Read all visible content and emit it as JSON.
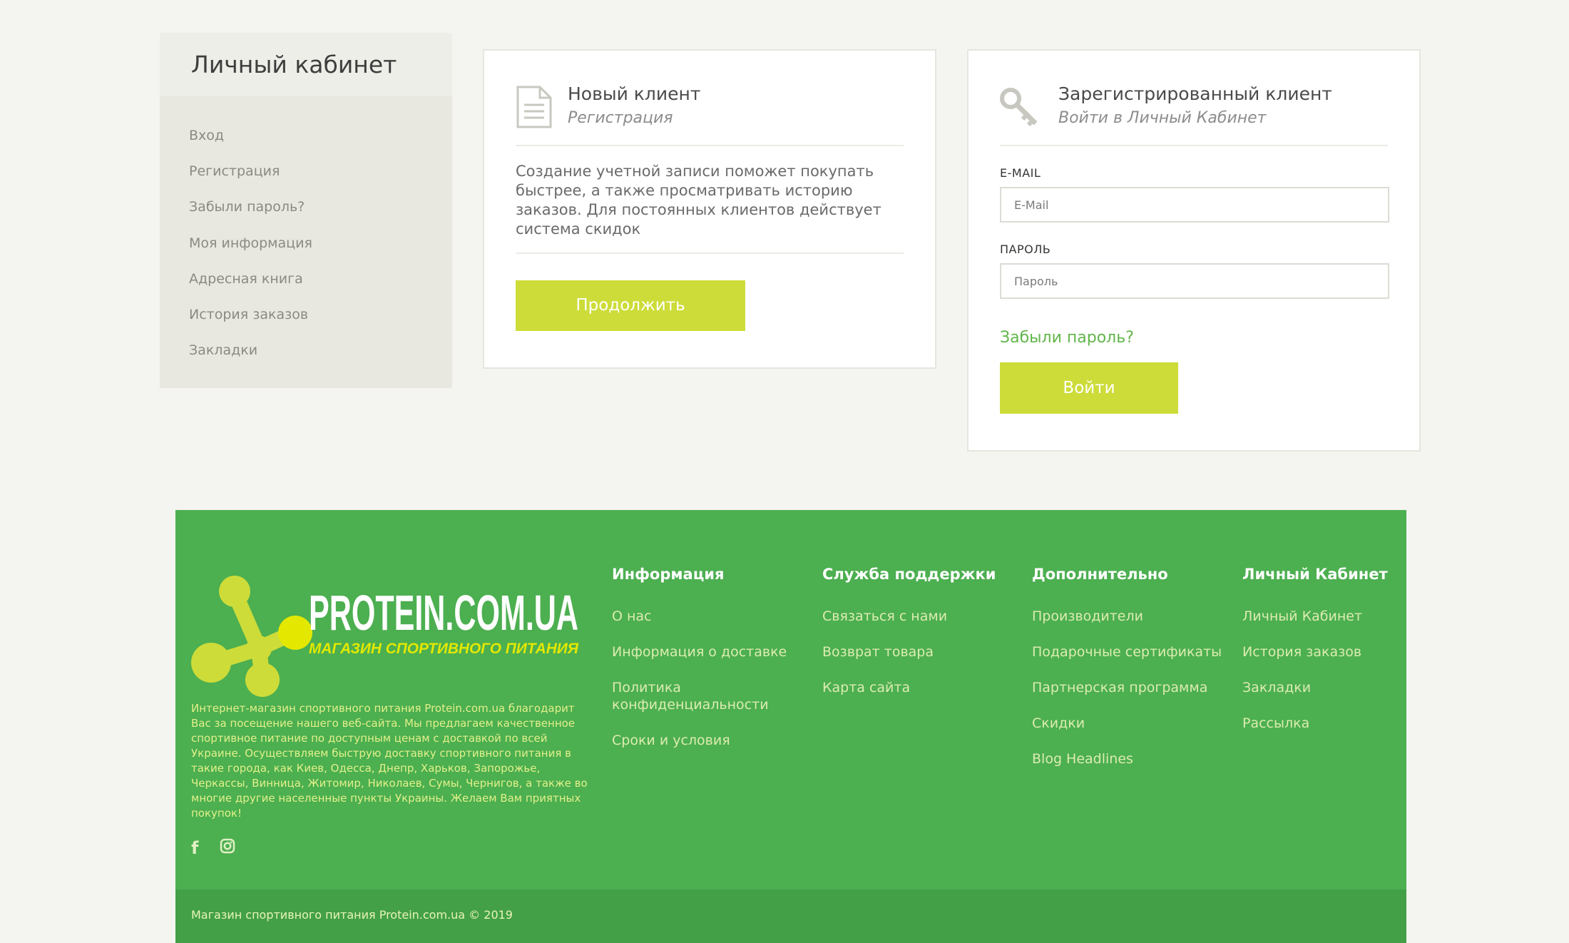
{
  "sidebar": {
    "title": "Личный кабинет",
    "items": [
      {
        "label": "Вход"
      },
      {
        "label": "Регистрация"
      },
      {
        "label": "Забыли пароль?"
      },
      {
        "label": "Моя информация"
      },
      {
        "label": "Адресная книга"
      },
      {
        "label": "История заказов"
      },
      {
        "label": "Закладки"
      }
    ]
  },
  "new_client": {
    "icon": "document-icon",
    "title": "Новый клиент",
    "subtitle": "Регистрация",
    "description": "Создание учетной записи поможет покупать быстрее, а также просматривать историю заказов. Для постоянных клиентов действует система скидок",
    "button": "Продолжить"
  },
  "registered_client": {
    "icon": "key-icon",
    "title": "Зарегистрированный клиент",
    "subtitle": "Войти в Личный Кабинет",
    "email_label": "E-MAIL",
    "email_placeholder": "E-Mail",
    "password_label": "ПАРОЛЬ",
    "password_placeholder": "Пароль",
    "forgot_link": "Забыли пароль?",
    "button": "Войти"
  },
  "footer": {
    "logo_text": "PROTEIN.COM.UA",
    "logo_tagline": "МАГАЗИН СПОРТИВНОГО ПИТАНИЯ",
    "about": "Интернет-магазин спортивного питания Protein.com.ua благодарит Вас за посещение нашего веб-сайта. Мы предлагаем качественное спортивное питание по доступным ценам с доставкой по всей Украине. Осуществляем быструю доставку спортивного питания в такие города, как Киев, Одесса, Днепр, Харьков, Запорожье, Черкассы, Винница, Житомир, Николаев, Сумы, Чернигов, а также во многие другие населенные пункты Украины. Желаем Вам приятных покупок!",
    "social": [
      {
        "icon": "facebook-icon",
        "glyph": "f"
      },
      {
        "icon": "instagram-icon",
        "glyph": "◙"
      }
    ],
    "columns": [
      {
        "heading": "Информация",
        "items": [
          "О нас",
          "Информация о доставке",
          "Политика конфиденциальности",
          "Сроки и условия"
        ]
      },
      {
        "heading": "Служба поддержки",
        "items": [
          "Связаться с нами",
          "Возврат товара",
          "Карта сайта"
        ]
      },
      {
        "heading": "Дополнительно",
        "items": [
          "Производители",
          "Подарочные сертификаты",
          "Партнерская программа",
          "Скидки",
          "Blog Headlines"
        ]
      },
      {
        "heading": "Личный Кабинет",
        "items": [
          "Личный Кабинет",
          "История заказов",
          "Закладки",
          "Рассылка"
        ]
      }
    ],
    "copyright": "Магазин спортивного питания Protein.com.ua © 2019"
  },
  "colors": {
    "accent_button": "#cddc39",
    "footer_green": "#4caf50",
    "footer_bottom": "#43a047",
    "link_green": "#62b54a",
    "logo_yellow": "#cddc39"
  }
}
